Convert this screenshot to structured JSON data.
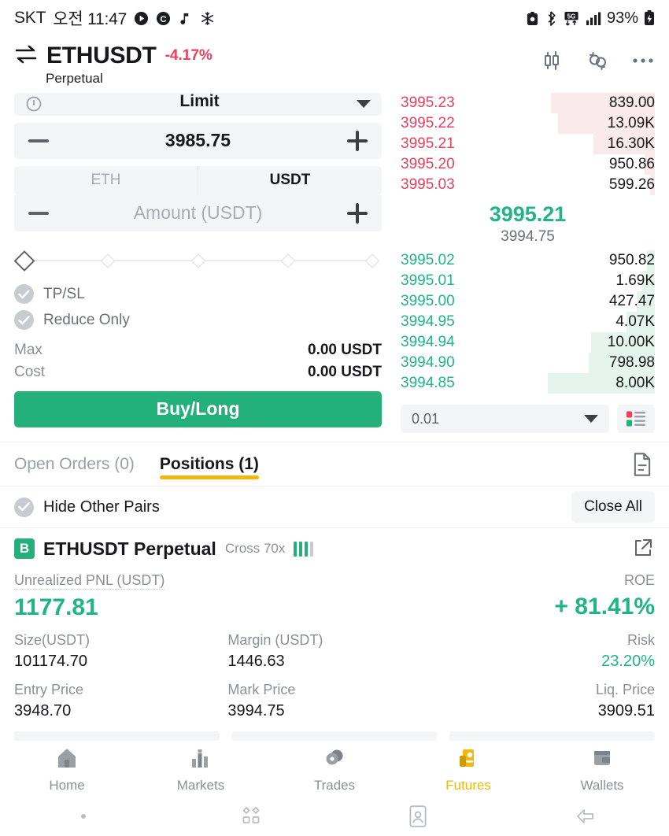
{
  "statusbar": {
    "carrier": "SKT",
    "time": "오전 11:47",
    "left_icons": [
      "play-circle-icon",
      "c-circle-icon",
      "music-note-icon",
      "snowflake-icon"
    ],
    "right_icons": [
      "alarm-icon",
      "bluetooth-icon",
      "5g-data-icon",
      "signal-bars-icon"
    ],
    "battery": "93%",
    "battery_icon": "battery-charging-icon"
  },
  "header": {
    "swap_icon": "swap-arrows-icon",
    "pair": "ETHUSDT",
    "change": "-4.17%",
    "change_color": "#e9415f",
    "subtitle": "Perpetual",
    "icons": [
      "candlestick-chart-icon",
      "funds-transfer-icon",
      "more-options-icon"
    ]
  },
  "order_form": {
    "info_icon": "info-icon",
    "order_type": "Limit",
    "price": "3985.75",
    "currency_tabs": [
      {
        "label": "ETH",
        "active": false
      },
      {
        "label": "USDT",
        "active": true
      }
    ],
    "amount_placeholder": "Amount (USDT)",
    "slider_percent": 0,
    "slider_ticks": [
      25,
      50,
      75,
      100
    ],
    "checkboxes": [
      {
        "label": "TP/SL",
        "checked": false
      },
      {
        "label": "Reduce Only",
        "checked": false
      }
    ],
    "rows": [
      {
        "key": "Max",
        "value": "0.00 USDT"
      },
      {
        "key": "Cost",
        "value": "0.00 USDT"
      }
    ],
    "submit_label": "Buy/Long",
    "submit_color": "#23b07b"
  },
  "orderbook": {
    "ask_color": "#e9415f",
    "bid_color": "#20b486",
    "ask_depth_color": "#fbeaec",
    "bid_depth_color": "#e6f4ee",
    "asks": [
      {
        "price": "3995.23",
        "qty": "839.00",
        "depth": 41
      },
      {
        "price": "3995.22",
        "qty": "13.09K",
        "depth": 38
      },
      {
        "price": "3995.21",
        "qty": "16.30K",
        "depth": 24
      },
      {
        "price": "3995.20",
        "qty": "950.86",
        "depth": 4
      },
      {
        "price": "3995.03",
        "qty": "599.26",
        "depth": 2
      }
    ],
    "bids": [
      {
        "price": "3995.02",
        "qty": "950.82",
        "depth": 3
      },
      {
        "price": "3995.01",
        "qty": "1.69K",
        "depth": 5
      },
      {
        "price": "3995.00",
        "qty": "427.47",
        "depth": 7
      },
      {
        "price": "3994.95",
        "qty": "4.07K",
        "depth": 11
      },
      {
        "price": "3994.94",
        "qty": "10.00K",
        "depth": 25
      },
      {
        "price": "3994.90",
        "qty": "798.98",
        "depth": 26
      },
      {
        "price": "3994.85",
        "qty": "8.00K",
        "depth": 42
      }
    ],
    "mid_price": "3995.21",
    "mark_price": "3994.75",
    "tick_size": "0.01",
    "depth_toggle_icon": "orderbook-layout-icon"
  },
  "tabs": {
    "items": [
      {
        "label": "Open Orders (0)",
        "active": false
      },
      {
        "label": "Positions (1)",
        "active": true
      }
    ],
    "doc_icon": "order-history-icon",
    "accent": "#f0b90b"
  },
  "filter": {
    "hide_other_pairs": "Hide Other Pairs",
    "hide_checked": false,
    "close_all": "Close All"
  },
  "position": {
    "badge": "B",
    "badge_color": "#23b07b",
    "name": "ETHUSDT Perpetual",
    "leverage": "Cross 70x",
    "risk_bars": 3,
    "risk_bars_total": 4,
    "share_icon": "share-external-icon",
    "pnl_label": "Unrealized PNL (USDT)",
    "pnl_value": "1177.81",
    "roe_label": "ROE",
    "roe_value": "+ 81.41%",
    "profit_color": "#20b486",
    "metrics": [
      {
        "label": "Size(USDT)",
        "value": "101174.70",
        "align": "left",
        "color": "#17181a"
      },
      {
        "label": "Margin (USDT)",
        "value": "1446.63",
        "align": "left",
        "color": "#17181a"
      },
      {
        "label": "Risk",
        "value": "23.20%",
        "align": "right",
        "color": "#20b486"
      },
      {
        "label": "Entry Price",
        "value": "3948.70",
        "align": "left",
        "color": "#17181a"
      },
      {
        "label": "Mark Price",
        "value": "3994.75",
        "align": "left",
        "color": "#17181a"
      },
      {
        "label": "Liq. Price",
        "value": "3909.51",
        "align": "right",
        "color": "#17181a"
      }
    ]
  },
  "bottomnav": {
    "items": [
      {
        "label": "Home",
        "icon": "home-icon",
        "active": false
      },
      {
        "label": "Markets",
        "icon": "markets-bars-icon",
        "active": false
      },
      {
        "label": "Trades",
        "icon": "trades-icon",
        "active": false
      },
      {
        "label": "Futures",
        "icon": "futures-icon",
        "active": true
      },
      {
        "label": "Wallets",
        "icon": "wallet-icon",
        "active": false
      }
    ],
    "active_color": "#f0b90b"
  },
  "sysnav": {
    "items": [
      "dot-indicator-icon",
      "recents-icon",
      "contact-card-icon",
      "back-arrow-icon"
    ]
  }
}
